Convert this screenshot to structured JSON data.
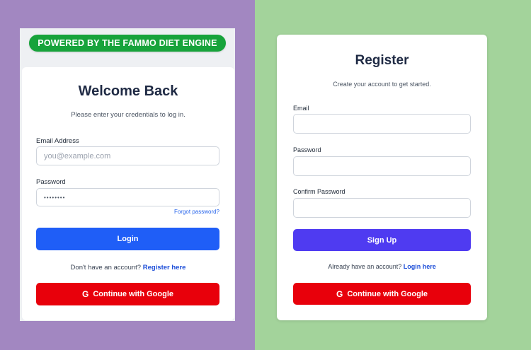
{
  "banner": {
    "text": "POWERED BY THE FAMMO DIET ENGINE"
  },
  "login": {
    "title": "Welcome Back",
    "subtitle": "Please enter your credentials to log in.",
    "email_label": "Email Address",
    "email_placeholder": "you@example.com",
    "password_label": "Password",
    "password_value": "••••••••",
    "forgot_label": "Forgot password?",
    "login_button": "Login",
    "no_account_text": "Don't have an account?",
    "register_link": "Register here",
    "google_button": "Continue with Google"
  },
  "register": {
    "title": "Register",
    "subtitle": "Create your account to get started.",
    "email_label": "Email",
    "password_label": "Password",
    "confirm_label": "Confirm Password",
    "signup_button": "Sign Up",
    "have_account_text": "Already have an account?",
    "login_link": "Login here",
    "google_button": "Continue with Google"
  },
  "icons": {
    "google": "G"
  },
  "colors": {
    "left_bg": "#a287c1",
    "right_bg": "#a3d39b",
    "banner": "#17a33b",
    "login_button": "#1f5ef7",
    "signup_button": "#4f3bf1",
    "google_button": "#e8000b"
  }
}
